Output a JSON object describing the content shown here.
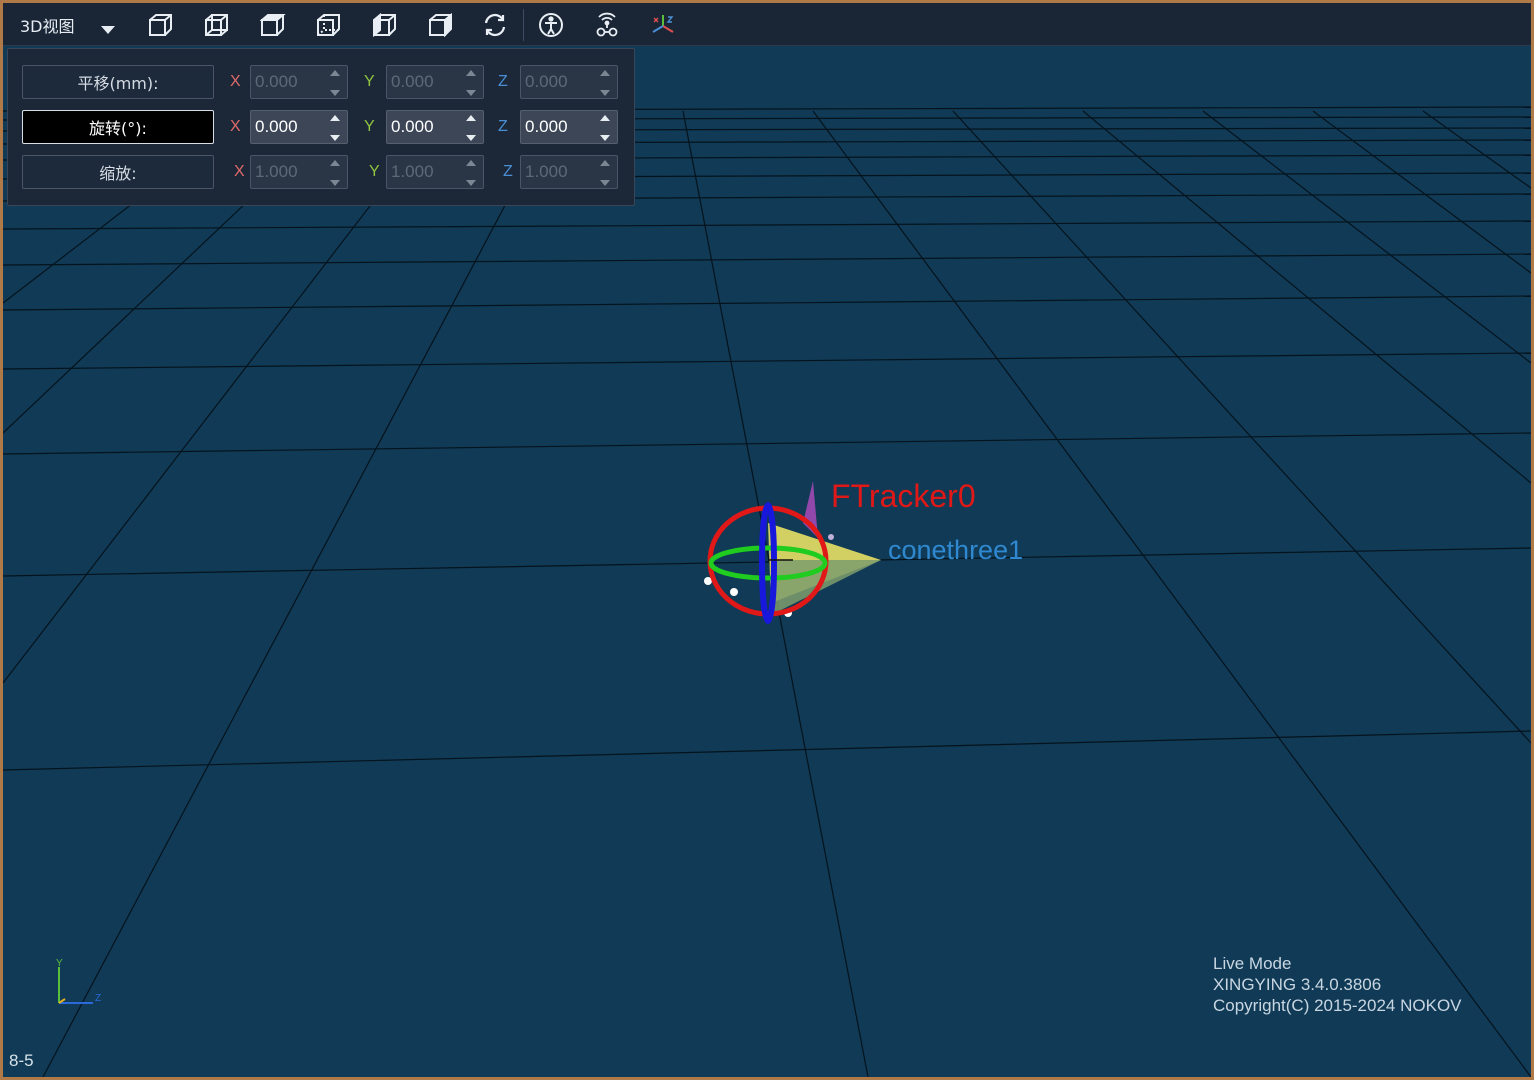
{
  "toolbar": {
    "view_mode": "3D视图",
    "view_buttons": [
      "front-view-icon",
      "back-view-icon",
      "top-view-icon",
      "bottom-view-icon",
      "left-view-icon",
      "right-view-icon",
      "reset-view-icon"
    ],
    "tool_buttons": [
      "skeleton-icon",
      "tracker-icon",
      "axis-icon"
    ]
  },
  "transform": {
    "translate": {
      "label": "平移(mm):",
      "x": "0.000",
      "y": "0.000",
      "z": "0.000",
      "enabled": false
    },
    "rotate": {
      "label": "旋转(°):",
      "x": "0.000",
      "y": "0.000",
      "z": "0.000",
      "enabled": true
    },
    "scale": {
      "label": "缩放:",
      "x": "1.000",
      "y": "1.000",
      "z": "1.000",
      "enabled": false
    },
    "axis_labels": {
      "x": "X",
      "y": "Y",
      "z": "Z"
    }
  },
  "scene": {
    "tracker_label": "FTracker0",
    "rigid_body_label": "conethree1",
    "axes_labels": {
      "y": "Y",
      "z": "Z"
    },
    "colors": {
      "background": "#103a55",
      "tracker": "#e01818",
      "rigid_body": "#2f88d0",
      "cone": "#e8e065"
    }
  },
  "info": {
    "mode": "Live Mode",
    "version": "XINGYING 3.4.0.3806",
    "copyright": "Copyright(C) 2015-2024 NOKOV"
  },
  "page_id": "8-5"
}
